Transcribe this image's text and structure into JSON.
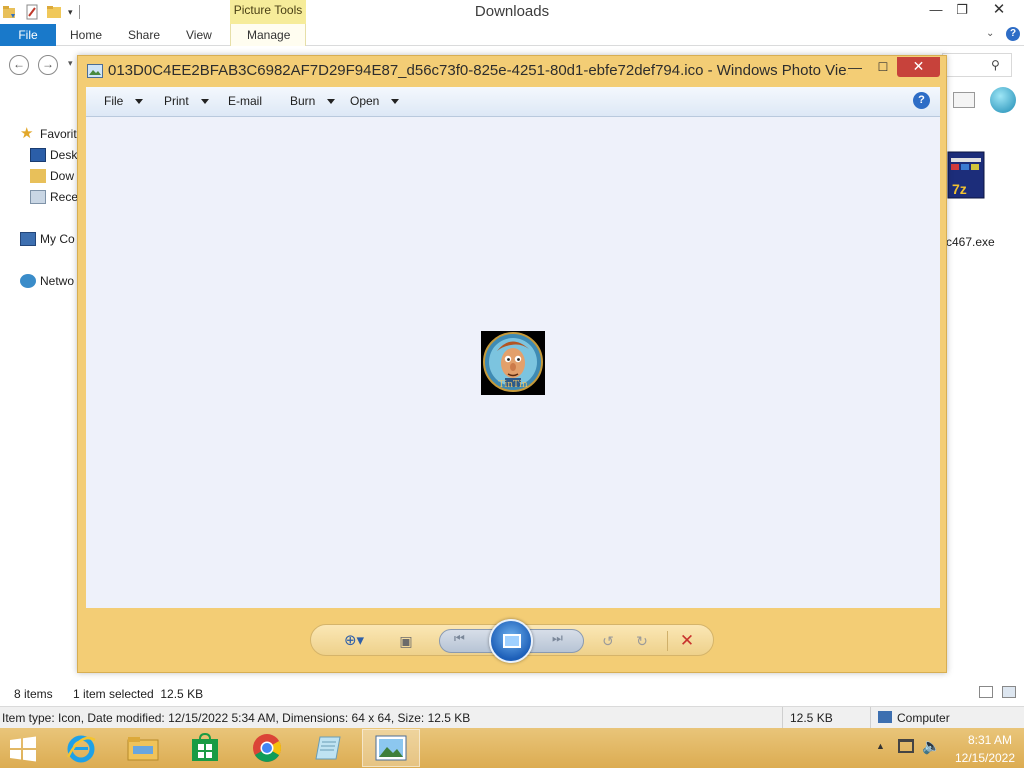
{
  "explorer": {
    "title": "Downloads",
    "contextual_tab_group": "Picture Tools",
    "tabs": {
      "file": "File",
      "home": "Home",
      "share": "Share",
      "view": "View",
      "manage": "Manage"
    },
    "nav": {
      "favorites": "Favorit",
      "desktop": "Desk",
      "downloads": "Dow",
      "recent": "Rece",
      "mycomputer": "My Co",
      "network": "Netwo"
    },
    "visible_file_name": "c467.exe",
    "status": {
      "items": "8 items",
      "selected": "1 item selected  12.5 KB"
    },
    "details_bar": {
      "text": "Item type: Icon, Date modified: 12/15/2022 5:34 AM, Dimensions: 64 x 64, Size: 12.5 KB",
      "size": "12.5 KB",
      "location": "Computer"
    }
  },
  "viewer": {
    "title": "013D0C4EE2BFAB3C6982AF7D29F94E87_d56c73f0-825e-4251-80d1-ebfe72def794.ico - Windows Photo Vie...",
    "menu": {
      "file": "File",
      "print": "Print",
      "email": "E-mail",
      "burn": "Burn",
      "open": "Open"
    },
    "image_caption": "TinTin"
  },
  "taskbar": {
    "time": "8:31 AM",
    "date": "12/15/2022"
  }
}
